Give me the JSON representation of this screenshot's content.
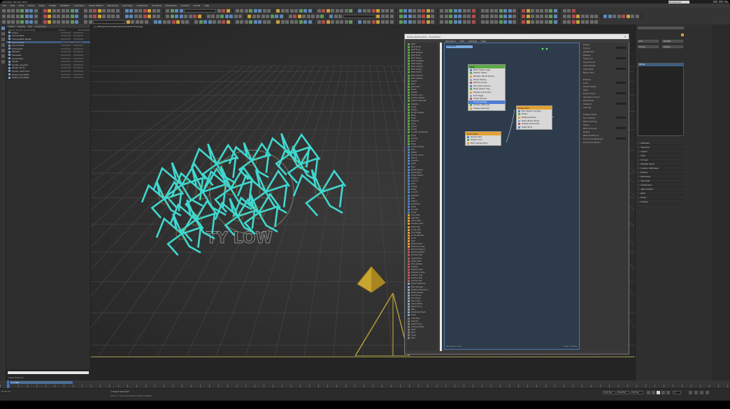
{
  "app": {
    "title": "Autodesk 3ds Max 2022",
    "workspace": "Workspaces: Default"
  },
  "menubar": [
    "File",
    "Edit",
    "Tools",
    "Group",
    "Views",
    "Create",
    "Modifiers",
    "Animation",
    "Graph Editors",
    "Rendering",
    "Civil View",
    "Customize",
    "Scripting",
    "Interactive",
    "Content",
    "Arnold",
    "Help"
  ],
  "scene_explorer": {
    "tabs": [
      "Select",
      "Display",
      "Edit",
      "Customize"
    ],
    "col_name": "Name (Sorted Ascending)",
    "col_frozen": "Frozen",
    "col_renderable": "Renderable",
    "rows": [
      {
        "label": "Scene",
        "sel": false
      },
      {
        "label": "Camera001",
        "sel": false
      },
      {
        "label": "Camera001.Target",
        "sel": false
      },
      {
        "label": "Dummy001",
        "sel": true
      },
      {
        "label": "Dummy002",
        "sel": false
      },
      {
        "label": "tyFlow001",
        "sel": false
      },
      {
        "label": "Text001",
        "sel": false
      },
      {
        "label": "Plane001",
        "sel": false
      },
      {
        "label": "Sphere001",
        "sel": false
      },
      {
        "label": "Spider",
        "sel": false
      },
      {
        "label": "Spider_Leg_Rig",
        "sel": false
      },
      {
        "label": "Spider_Body",
        "sel": false
      },
      {
        "label": "Spider_Abdomen",
        "sel": false
      },
      {
        "label": "Helper_Point001",
        "sel": false
      },
      {
        "label": "Helper_Point002",
        "sel": false
      }
    ],
    "footer": "Layer Explorer"
  },
  "viewport": {
    "label": "[+] [Perspective] [Standard] [Default Shading]",
    "logo_text": "TY LOW"
  },
  "tyflow_editor": {
    "title": "tyFlow [tyFlow001] - Flow Editor",
    "menus": [
      "Operators",
      "Edit",
      "Settings",
      "Help"
    ],
    "canvas_tab": "tyFlow001",
    "canvas_footer_left": "Rendering: 0 ops",
    "canvas_footer_right": "Flow: 3 Events",
    "depot": [
      "Birth",
      "Birth Burst",
      "Birth Flow",
      "Birth Objects",
      "Birth Fluid",
      "Birth PhysX",
      "Birth Skeleton",
      "Birth Spline",
      "Birth Surface",
      "Birth Voxels",
      "Birth Tracks",
      "Birth Volume",
      "Birth Splines",
      "Spawn",
      "Split",
      "Send Out",
      "Event",
      "Delete",
      "Position Icon",
      "Position Object",
      "Position Raycast",
      "Rotation",
      "Scale",
      "Shape",
      "Shape Display",
      "Mass",
      "Mesh",
      "Material",
      "Copy",
      "Export",
      "Cache",
      "Custom Properties",
      "Force",
      "Gravity",
      "Wind",
      "Drag",
      "Follow Surface",
      "Spin",
      "Speed",
      "Surface Force",
      "Spring",
      "Collision",
      "Cloth",
      "Bind",
      "PhysX Shape",
      "PhysX Bind",
      "PhysX Switch",
      "Fracture",
      "Voronoi",
      "Slice",
      "Cluster",
      "Break",
      "Growth",
      "Skeleton",
      "Skin",
      "Attach",
      "Subdivide",
      "Relax",
      "Smooth",
      "Script",
      "Time Test",
      "Age Test",
      "Count Test",
      "Property Test",
      "Mesh Test",
      "Script Test",
      "Find Target",
      "Go To Rotation",
      "Limit",
      "Goal",
      "Particle Bind",
      "Particle Groups",
      "Particle Physics",
      "Particle Switch",
      "Surface Test",
      "Object Bind",
      "Object Test",
      "Flow Update",
      "Display",
      "Display Data",
      "Display Groups",
      "Camera Cull",
      "Camera Test",
      "Camera IDs",
      "Export Particles",
      "Birth Preview",
      "Material Frequency",
      "Mesh Display",
      "Point Force",
      "Set Values",
      "Spin Limit",
      "Spline Paths",
      "Spline Force",
      "Stop",
      "Subdivide Mesh",
      "Trails",
      "UVW Map",
      "Velocity",
      "Vertex Color",
      "Volume Break",
      "Weld",
      "Wire",
      "Voxel",
      "Zero"
    ],
    "nodes": [
      {
        "title": "Birth",
        "rows": [
          "Birth (Spider Legs)",
          "Position Object",
          "Rotation (World Space)",
          "Shape Display",
          "Particle Groups",
          "Spin (World Space)",
          "Mesh (Spider Leg)",
          "Display (Geometry)",
          "Find Target",
          "Follow Surface",
          "Force (Gravity)",
          "Collision (Bounce)",
          "Display (Vertices)"
        ],
        "selected_index": 10
      },
      {
        "title": "Event 002",
        "rows": [
          "Surface Test",
          "Position Icon",
          "Birth (Spider Body)"
        ]
      },
      {
        "title": "Event 003",
        "rows": [
          "Bind (Spider Leg Rig)",
          "Shape",
          "Material Display",
          "Mesh (Spider Body)",
          "Display (Geometry)",
          "Object Bind"
        ]
      }
    ],
    "props": [
      "tyFlow",
      "Timing",
      "Global Spin",
      "Display",
      "Show Icon",
      "Override All",
      "Auto Update",
      "Interactive",
      "Pause Flow",
      "Preview",
      "Limit",
      "Global Speed",
      "Start",
      "Event Count",
      "Operators Count",
      "Reset Flow",
      "Viewport",
      "Caching",
      "Enable Cache",
      "Set Timeline",
      "Mesh Caching",
      "Solver",
      "Particle Count",
      "Debug",
      "Particle Memory",
      "Errors and Warnings",
      "Errors and Others"
    ]
  },
  "command_panel": {
    "sections": [
      "Modifiers",
      "Selection",
      "Layers",
      "Split",
      "Unique",
      "Modifier Stack",
      "Custom Attributes",
      "Rollout",
      "Edit Mode",
      "Generate",
      "Subdivision",
      "Optimization",
      "Birth",
      "Event",
      "Display"
    ],
    "list_selected": "tyFlow",
    "buttons": [
      "Pick",
      "Modifier",
      "Timing",
      "Display"
    ]
  },
  "timeline": {
    "current": "0 / 100",
    "status_line1": "1 Object Selected",
    "status_line2": "Click or click-and-drag to select objects",
    "maxscript": "MAXScript",
    "frame": "0",
    "auto_key": "Auto Key",
    "set_key": "Set Key",
    "selected": "Selected"
  },
  "colors": {
    "wire": "#3fd8cf",
    "gizmo": "#c8a431",
    "node_header_green": "#5ca845",
    "node_header_orange": "#e4a130",
    "canvas": "#2d3b4a",
    "selection": "#4e7dd2"
  }
}
